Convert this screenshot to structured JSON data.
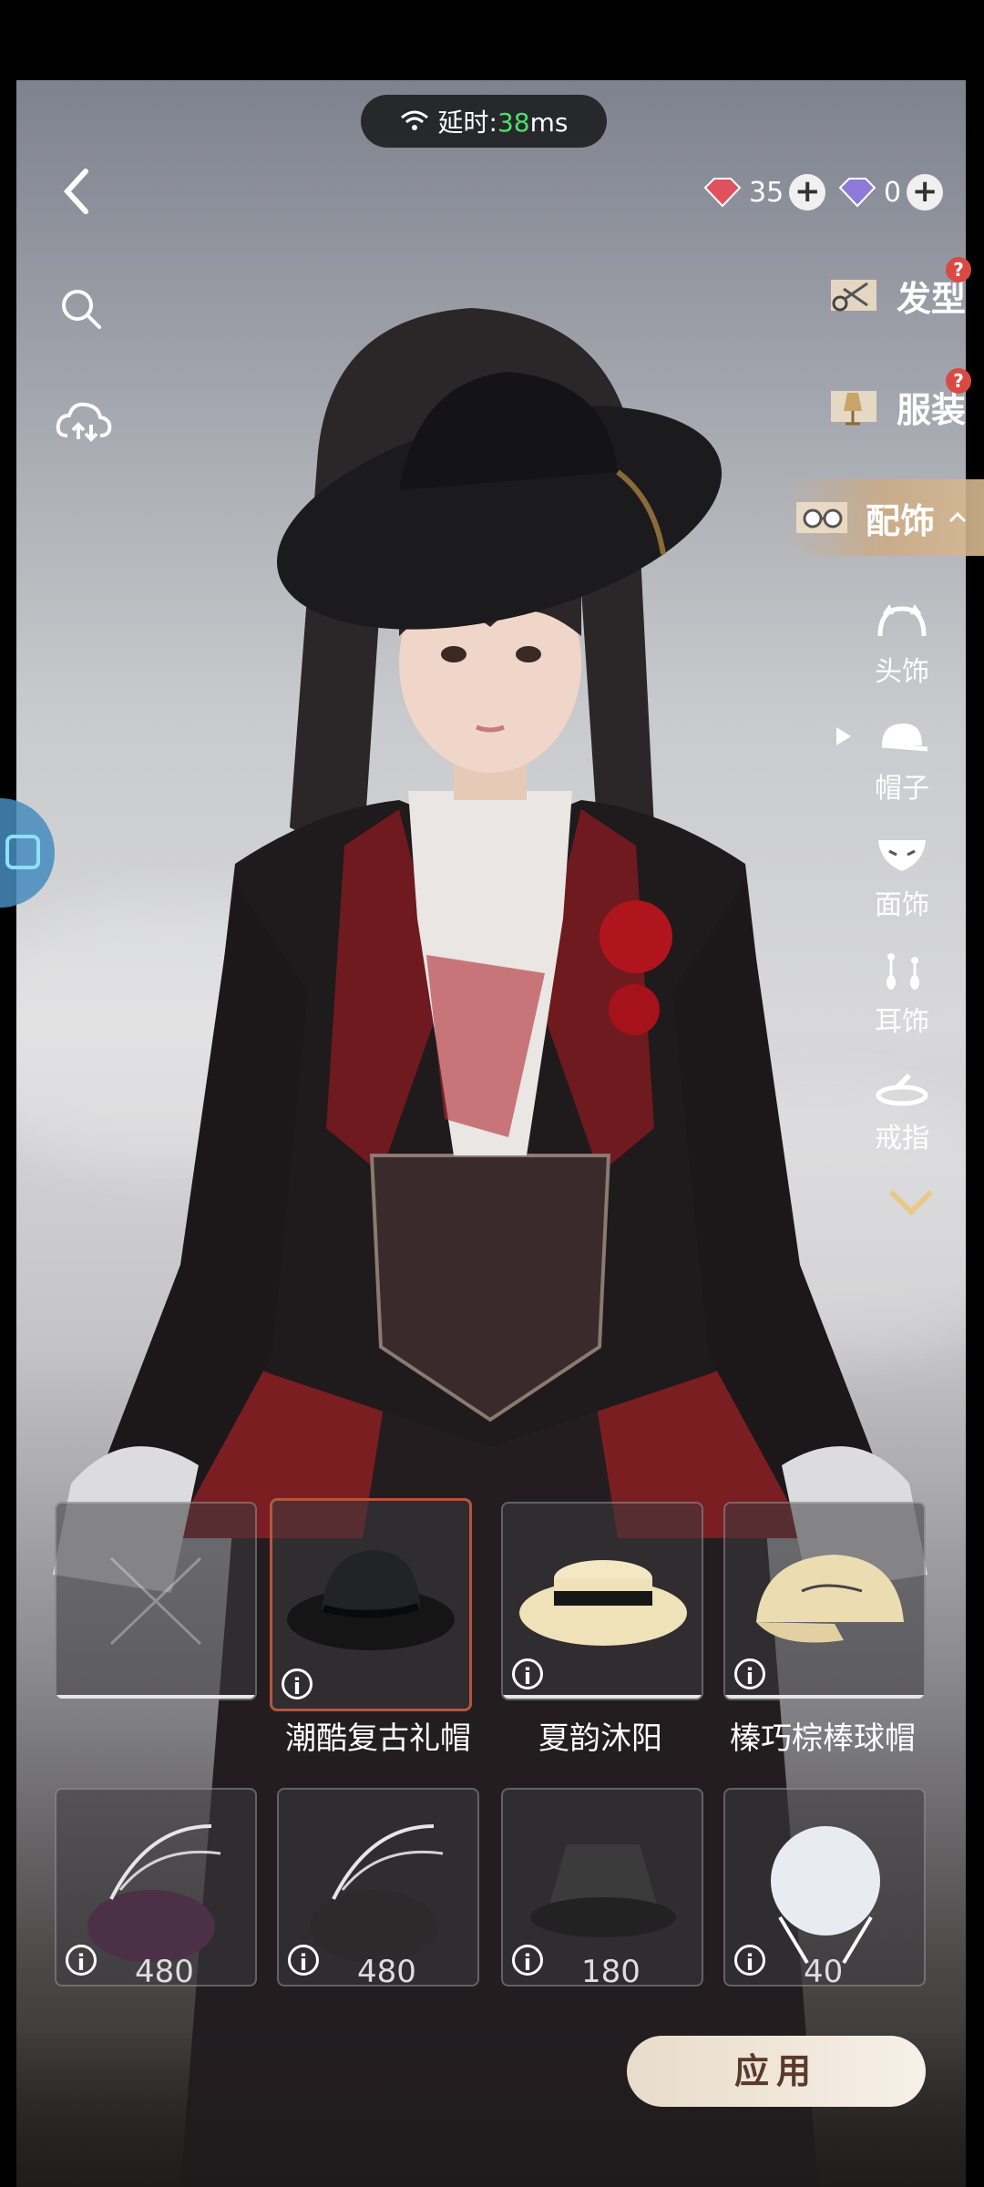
{
  "status": {
    "latency_label": "延时:",
    "latency_value": "38",
    "latency_unit": "ms"
  },
  "currency": [
    {
      "icon": "red-gem-icon",
      "amount": "35"
    },
    {
      "icon": "purple-gem-icon",
      "amount": "0"
    }
  ],
  "categories": [
    {
      "label": "发型",
      "icon": "scissors-icon",
      "badge": "?"
    },
    {
      "label": "服装",
      "icon": "mannequin-icon",
      "badge": "?"
    },
    {
      "label": "配饰",
      "icon": "glasses-icon",
      "active": true
    }
  ],
  "subcategories": [
    {
      "label": "头饰",
      "icon": "headband-icon"
    },
    {
      "label": "帽子",
      "icon": "cap-icon",
      "selected": true
    },
    {
      "label": "面饰",
      "icon": "mask-icon"
    },
    {
      "label": "耳饰",
      "icon": "earring-icon"
    },
    {
      "label": "戒指",
      "icon": "ring-icon"
    }
  ],
  "items_row1": [
    {
      "name": "",
      "kind": "none"
    },
    {
      "name": "潮酷复古礼帽",
      "kind": "fedora",
      "selected": true
    },
    {
      "name": "夏韵沐阳",
      "kind": "boater"
    },
    {
      "name": "榛巧棕棒球帽",
      "kind": "baseball-cap"
    }
  ],
  "items_row2": [
    {
      "price": "480",
      "kind": "feather-hat-purple"
    },
    {
      "price": "480",
      "kind": "feather-hat-black"
    },
    {
      "price": "180",
      "kind": "bucket-hat"
    },
    {
      "price": "40",
      "kind": "bonnet"
    }
  ],
  "apply_label": "应用",
  "colors": {
    "accent": "#b3563f",
    "latency_green": "#49e36a",
    "badge_red": "#d94a45"
  }
}
